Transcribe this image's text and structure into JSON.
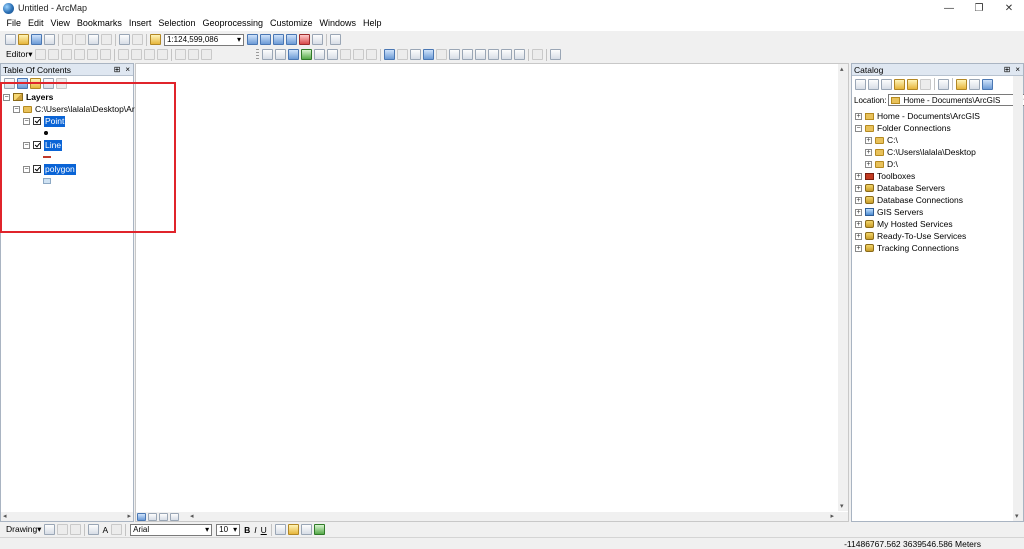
{
  "window": {
    "title": "Untitled - ArcMap",
    "controls": {
      "min": "—",
      "max": "❐",
      "close": "✕"
    }
  },
  "menu": [
    "File",
    "Edit",
    "View",
    "Bookmarks",
    "Insert",
    "Selection",
    "Geoprocessing",
    "Customize",
    "Windows",
    "Help"
  ],
  "toolbar": {
    "scale": "1:124,599,086",
    "editor_label": "Editor▾",
    "drawing_label": "Drawing▾",
    "font_name": "Arial",
    "font_size": "10",
    "bold": "B",
    "italic": "I",
    "underline": "U",
    "text_tool": "A"
  },
  "toc": {
    "title": "Table Of Contents",
    "root": "Layers",
    "folder": "C:\\Users\\lalala\\Desktop\\Arc",
    "layers": [
      {
        "name": "Point",
        "symbol": "point",
        "checked": true
      },
      {
        "name": "Line",
        "symbol": "line",
        "checked": true
      },
      {
        "name": "polygon",
        "symbol": "polygon",
        "checked": true
      }
    ]
  },
  "catalog": {
    "title": "Catalog",
    "location_label": "Location:",
    "location_value": "Home - Documents\\ArcGIS",
    "items": [
      {
        "label": "Home - Documents\\ArcGIS",
        "level": 0,
        "icon": "home-folder-icon"
      },
      {
        "label": "Folder Connections",
        "level": 0,
        "icon": "folder-connections-icon"
      },
      {
        "label": "C:\\",
        "level": 1,
        "icon": "drive-icon"
      },
      {
        "label": "C:\\Users\\lalala\\Desktop",
        "level": 1,
        "icon": "folder-icon"
      },
      {
        "label": "D:\\",
        "level": 1,
        "icon": "drive-icon"
      },
      {
        "label": "Toolboxes",
        "level": 0,
        "icon": "toolbox-icon"
      },
      {
        "label": "Database Servers",
        "level": 0,
        "icon": "database-icon"
      },
      {
        "label": "Database Connections",
        "level": 0,
        "icon": "database-icon"
      },
      {
        "label": "GIS Servers",
        "level": 0,
        "icon": "gis-server-icon"
      },
      {
        "label": "My Hosted Services",
        "level": 0,
        "icon": "database-icon"
      },
      {
        "label": "Ready-To-Use Services",
        "level": 0,
        "icon": "database-icon"
      },
      {
        "label": "Tracking Connections",
        "level": 0,
        "icon": "database-icon"
      }
    ]
  },
  "status": {
    "coordinates": "-11486767.562  3639546.586 Meters"
  },
  "colors": {
    "highlight": "#0a64d6",
    "annotation_box": "#e0242b"
  }
}
